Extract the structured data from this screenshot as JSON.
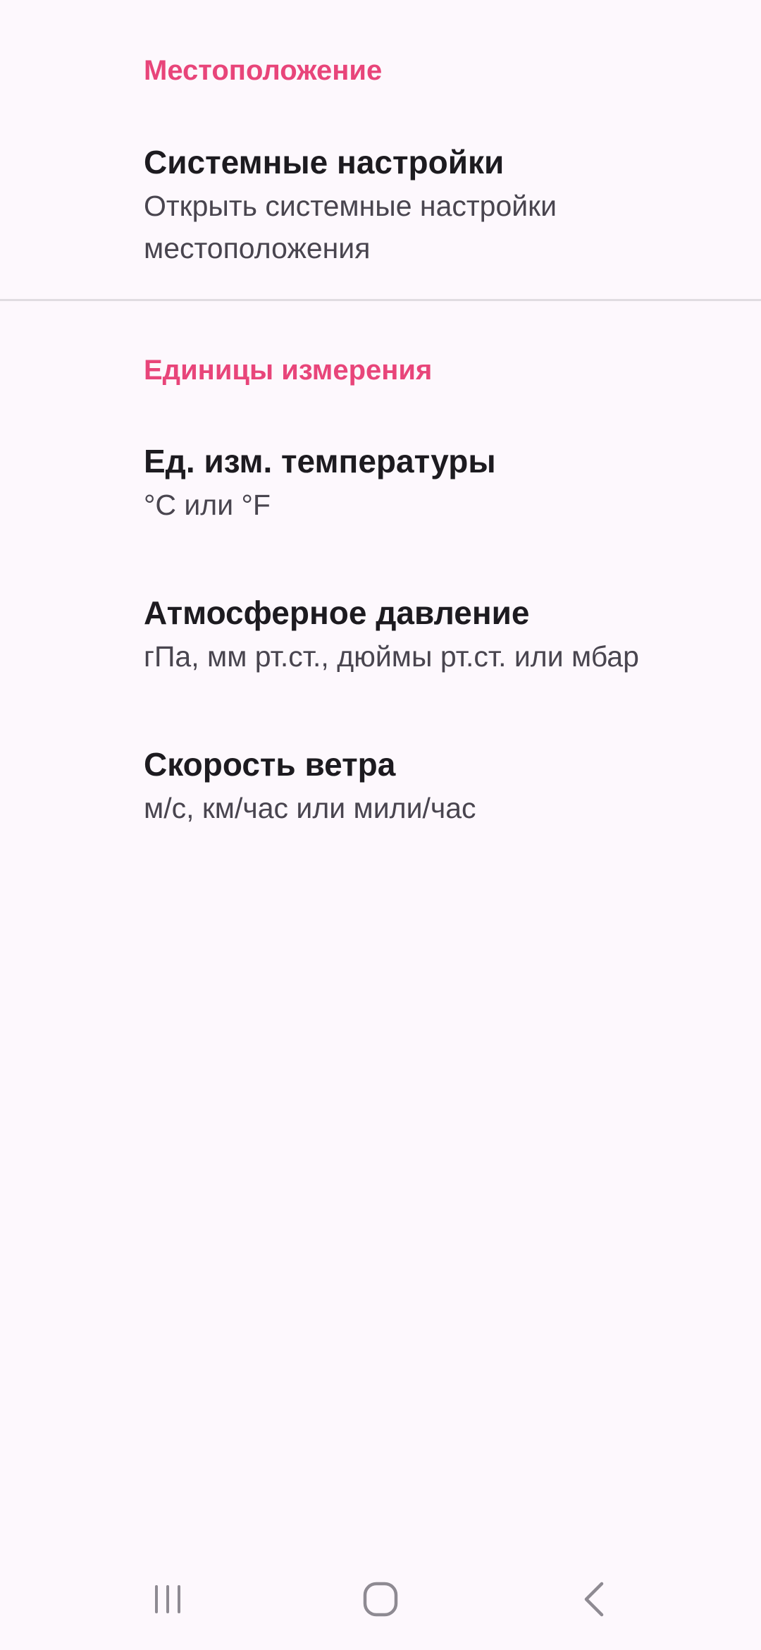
{
  "sections": {
    "location": {
      "header": "Местоположение",
      "items": [
        {
          "title": "Системные настройки",
          "summary": "Открыть системные настройки местоположения"
        }
      ]
    },
    "units": {
      "header": "Единицы измерения",
      "items": [
        {
          "title": "Ед. изм. температуры",
          "summary": "°C или °F"
        },
        {
          "title": "Атмосферное давление",
          "summary": "гПа, мм рт.ст., дюймы рт.ст. или мбар"
        },
        {
          "title": "Скорость ветра",
          "summary": "м/с, км/час или мили/час"
        }
      ]
    }
  },
  "navbar": {
    "buttons": [
      {
        "icon": "recent-apps-icon"
      },
      {
        "icon": "home-icon"
      },
      {
        "icon": "back-icon"
      }
    ]
  },
  "colors": {
    "background": "#FDF8FD",
    "accent": "#E8457A",
    "title": "#1D1B20",
    "summary": "#49454F",
    "divider": "#E0DCE1"
  }
}
